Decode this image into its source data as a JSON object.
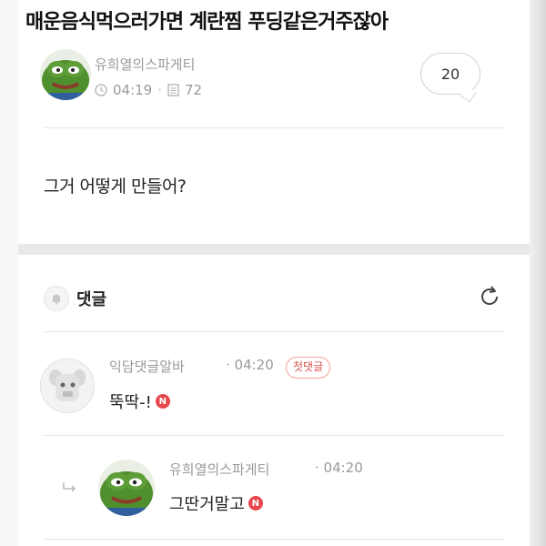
{
  "post": {
    "title": "매운음식먹으러가면 계란찜 푸딩같은거주잖아",
    "author": "유희열의스파게티",
    "time": "04:19",
    "views": "72",
    "comment_count": "20",
    "body": "그거 어떻게 만들어?"
  },
  "comments_section": {
    "label": "댓글"
  },
  "comments": [
    {
      "author": "익담댓글알바",
      "time": "· 04:20",
      "badge": "첫댓글",
      "text": "뚝딱-!",
      "new_label": "N"
    },
    {
      "author": "유희열의스파게티",
      "time": "· 04:20",
      "text": "그딴거말고",
      "new_label": "N"
    }
  ],
  "colors": {
    "new_badge": "#e8474c",
    "first_badge_border": "#f2a0a0",
    "muted_text": "#9a9a9a",
    "pepe_green": "#4f8f2e"
  },
  "icons": [
    "clock-icon",
    "document-icon",
    "bell-icon",
    "refresh-icon",
    "reply-arrow-icon"
  ]
}
